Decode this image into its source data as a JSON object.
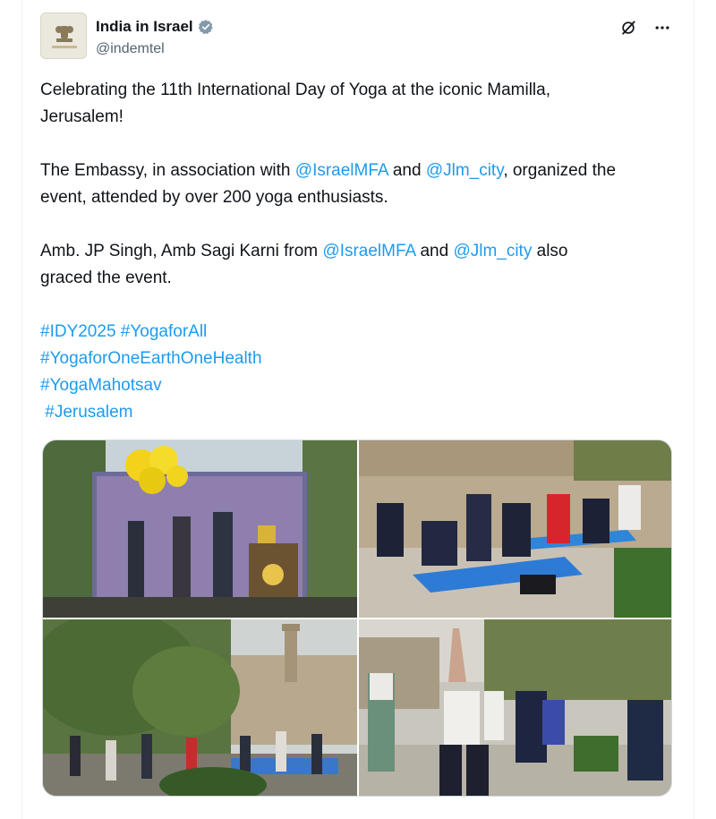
{
  "author": {
    "name": "India in Israel",
    "handle": "@indemtel"
  },
  "post": {
    "line1": "Celebrating the 11th International Day of Yoga at the iconic Mamilla,",
    "line2": "Jerusalem!",
    "p2_a": "The Embassy, in association with ",
    "p2_link1": "@IsraelMFA",
    "p2_b": " and ",
    "p2_link2": "@Jlm_city",
    "p2_c": ", organized the",
    "p2_line2": "event, attended by over 200 yoga enthusiasts.",
    "p3_a": "Amb. JP Singh, Amb Sagi Karni from ",
    "p3_link1": "@IsraelMFA",
    "p3_b": " and ",
    "p3_link2": "@Jlm_city",
    "p3_c": " also",
    "p3_line2": "graced the event.",
    "hashtags": [
      "#IDY2025",
      "#YogaforAll",
      "#YogaforOneEarthOneHealth",
      "#YogaMahotsav",
      "#Jerusalem"
    ]
  },
  "icons": {
    "verified": "verified-badge-icon",
    "grok": "grok-icon",
    "more": "more-icon"
  },
  "colors": {
    "link": "#1d9bf0",
    "text": "#0f1419",
    "secondary": "#536471",
    "verified": "#829aab"
  }
}
